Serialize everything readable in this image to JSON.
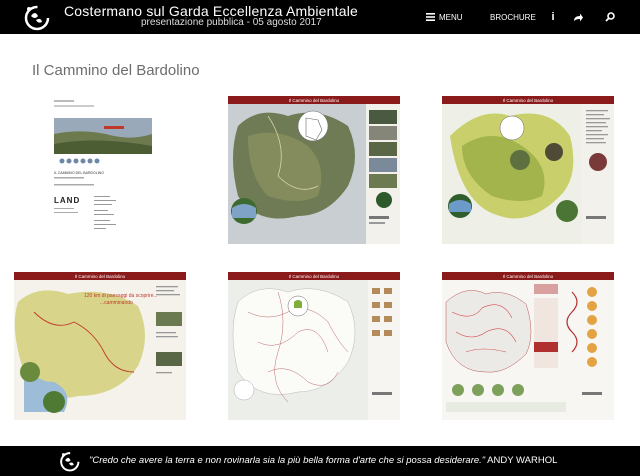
{
  "header": {
    "title": "Costermano sul Garda Eccellenza Ambientale",
    "subtitle": "presentazione pubblica - 05 agosto 2017",
    "menu_label": "MENU",
    "brochure_label": "BROCHURE",
    "info_icon": "info-icon",
    "share_icon": "share-icon",
    "search_icon": "search-icon"
  },
  "page": {
    "title": "Il Cammino del Bardolino"
  },
  "gallery": {
    "items": [
      {
        "name": "cover-page"
      },
      {
        "name": "map-satellite",
        "banner": "Il Cammino del Bardolino"
      },
      {
        "name": "map-vineyards",
        "banner": "Il Cammino del Bardolino"
      },
      {
        "name": "map-illustrated",
        "banner": "Il Cammino del Bardolino",
        "caption_line1": "120 km di paesaggi da scoprire...",
        "caption_line2": "...camminando"
      },
      {
        "name": "map-lines",
        "banner": "Il Cammino del Bardolino"
      },
      {
        "name": "map-detail",
        "banner": "Il Cammino del Bardolino"
      }
    ],
    "cover": {
      "line1": "IL CAMMINO DEL BARDOLINO",
      "logo_text": "LAND"
    }
  },
  "footer": {
    "quote": "\"Credo che avere la terra e non rovinarla sia la più bella forma d'arte che si possa desiderare.\"",
    "author": "ANDY WARHOL"
  },
  "colors": {
    "banner": "#8b1a1a",
    "bar": "#000000"
  }
}
